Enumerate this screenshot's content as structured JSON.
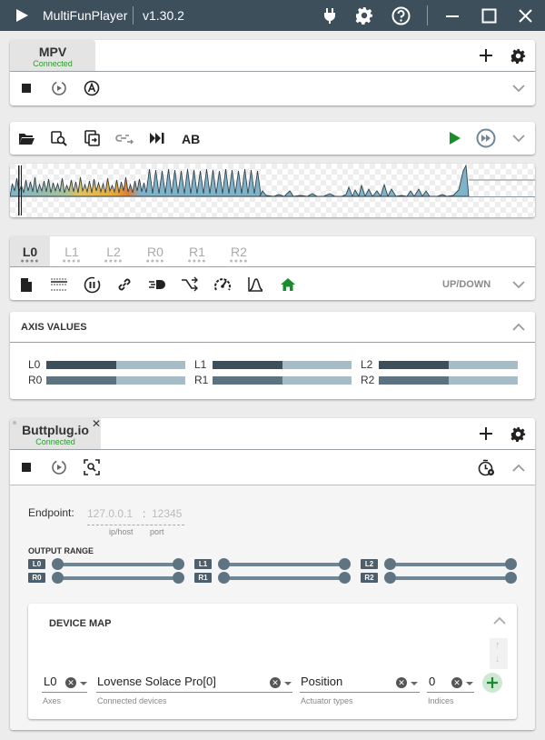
{
  "app": {
    "title": "MultiFunPlayer",
    "version": "v1.30.2"
  },
  "mpv": {
    "name": "MPV",
    "status": "Connected"
  },
  "script_toolbar": {
    "ab_label": "AB"
  },
  "axis_tabs": [
    "L0",
    "L1",
    "L2",
    "R0",
    "R1",
    "R2"
  ],
  "motion_label": "UP/DOWN",
  "axis_values": {
    "title": "AXIS VALUES",
    "items": [
      {
        "label": "L0",
        "value": 0.5
      },
      {
        "label": "L1",
        "value": 0.5
      },
      {
        "label": "L2",
        "value": 0.5
      },
      {
        "label": "R0",
        "value": 0.5
      },
      {
        "label": "R1",
        "value": 0.5
      },
      {
        "label": "R2",
        "value": 0.5
      }
    ]
  },
  "buttplug": {
    "name": "Buttplug.io",
    "status": "Connected",
    "endpoint_label": "Endpoint:",
    "host": "127.0.0.1",
    "host_sep": ":",
    "port": "12345",
    "host_caption": "ip/host",
    "port_caption": "port",
    "output_range_title": "OUTPUT RANGE",
    "range_tags": [
      "L0",
      "R0",
      "L1",
      "R1",
      "L2",
      "R2"
    ],
    "device_map": {
      "title": "DEVICE MAP",
      "axis": "L0",
      "axis_caption": "Axes",
      "device": "Lovense Solace Pro[0]",
      "device_caption": "Connected devices",
      "actuator": "Position",
      "actuator_caption": "Actuator types",
      "index": "0",
      "index_caption": "Indices"
    }
  },
  "colors": {
    "titlebar": "#3e4f5c",
    "connected": "#2a9d2a",
    "play": "#1a8c2e",
    "home": "#1a8c2e",
    "bar_fill": "#3e4f5c",
    "bar_track": "#a6bdc7"
  }
}
